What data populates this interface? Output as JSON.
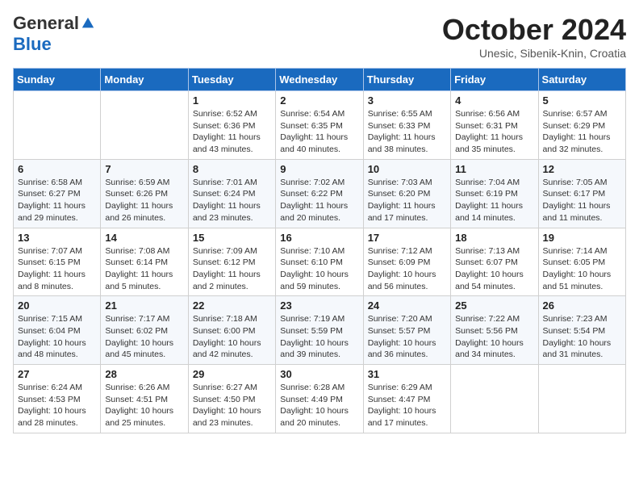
{
  "header": {
    "logo_general": "General",
    "logo_blue": "Blue",
    "month_title": "October 2024",
    "subtitle": "Unesic, Sibenik-Knin, Croatia"
  },
  "calendar": {
    "days_of_week": [
      "Sunday",
      "Monday",
      "Tuesday",
      "Wednesday",
      "Thursday",
      "Friday",
      "Saturday"
    ],
    "weeks": [
      [
        {
          "day": "",
          "content": ""
        },
        {
          "day": "",
          "content": ""
        },
        {
          "day": "1",
          "content": "Sunrise: 6:52 AM\nSunset: 6:36 PM\nDaylight: 11 hours and 43 minutes."
        },
        {
          "day": "2",
          "content": "Sunrise: 6:54 AM\nSunset: 6:35 PM\nDaylight: 11 hours and 40 minutes."
        },
        {
          "day": "3",
          "content": "Sunrise: 6:55 AM\nSunset: 6:33 PM\nDaylight: 11 hours and 38 minutes."
        },
        {
          "day": "4",
          "content": "Sunrise: 6:56 AM\nSunset: 6:31 PM\nDaylight: 11 hours and 35 minutes."
        },
        {
          "day": "5",
          "content": "Sunrise: 6:57 AM\nSunset: 6:29 PM\nDaylight: 11 hours and 32 minutes."
        }
      ],
      [
        {
          "day": "6",
          "content": "Sunrise: 6:58 AM\nSunset: 6:27 PM\nDaylight: 11 hours and 29 minutes."
        },
        {
          "day": "7",
          "content": "Sunrise: 6:59 AM\nSunset: 6:26 PM\nDaylight: 11 hours and 26 minutes."
        },
        {
          "day": "8",
          "content": "Sunrise: 7:01 AM\nSunset: 6:24 PM\nDaylight: 11 hours and 23 minutes."
        },
        {
          "day": "9",
          "content": "Sunrise: 7:02 AM\nSunset: 6:22 PM\nDaylight: 11 hours and 20 minutes."
        },
        {
          "day": "10",
          "content": "Sunrise: 7:03 AM\nSunset: 6:20 PM\nDaylight: 11 hours and 17 minutes."
        },
        {
          "day": "11",
          "content": "Sunrise: 7:04 AM\nSunset: 6:19 PM\nDaylight: 11 hours and 14 minutes."
        },
        {
          "day": "12",
          "content": "Sunrise: 7:05 AM\nSunset: 6:17 PM\nDaylight: 11 hours and 11 minutes."
        }
      ],
      [
        {
          "day": "13",
          "content": "Sunrise: 7:07 AM\nSunset: 6:15 PM\nDaylight: 11 hours and 8 minutes."
        },
        {
          "day": "14",
          "content": "Sunrise: 7:08 AM\nSunset: 6:14 PM\nDaylight: 11 hours and 5 minutes."
        },
        {
          "day": "15",
          "content": "Sunrise: 7:09 AM\nSunset: 6:12 PM\nDaylight: 11 hours and 2 minutes."
        },
        {
          "day": "16",
          "content": "Sunrise: 7:10 AM\nSunset: 6:10 PM\nDaylight: 10 hours and 59 minutes."
        },
        {
          "day": "17",
          "content": "Sunrise: 7:12 AM\nSunset: 6:09 PM\nDaylight: 10 hours and 56 minutes."
        },
        {
          "day": "18",
          "content": "Sunrise: 7:13 AM\nSunset: 6:07 PM\nDaylight: 10 hours and 54 minutes."
        },
        {
          "day": "19",
          "content": "Sunrise: 7:14 AM\nSunset: 6:05 PM\nDaylight: 10 hours and 51 minutes."
        }
      ],
      [
        {
          "day": "20",
          "content": "Sunrise: 7:15 AM\nSunset: 6:04 PM\nDaylight: 10 hours and 48 minutes."
        },
        {
          "day": "21",
          "content": "Sunrise: 7:17 AM\nSunset: 6:02 PM\nDaylight: 10 hours and 45 minutes."
        },
        {
          "day": "22",
          "content": "Sunrise: 7:18 AM\nSunset: 6:00 PM\nDaylight: 10 hours and 42 minutes."
        },
        {
          "day": "23",
          "content": "Sunrise: 7:19 AM\nSunset: 5:59 PM\nDaylight: 10 hours and 39 minutes."
        },
        {
          "day": "24",
          "content": "Sunrise: 7:20 AM\nSunset: 5:57 PM\nDaylight: 10 hours and 36 minutes."
        },
        {
          "day": "25",
          "content": "Sunrise: 7:22 AM\nSunset: 5:56 PM\nDaylight: 10 hours and 34 minutes."
        },
        {
          "day": "26",
          "content": "Sunrise: 7:23 AM\nSunset: 5:54 PM\nDaylight: 10 hours and 31 minutes."
        }
      ],
      [
        {
          "day": "27",
          "content": "Sunrise: 6:24 AM\nSunset: 4:53 PM\nDaylight: 10 hours and 28 minutes."
        },
        {
          "day": "28",
          "content": "Sunrise: 6:26 AM\nSunset: 4:51 PM\nDaylight: 10 hours and 25 minutes."
        },
        {
          "day": "29",
          "content": "Sunrise: 6:27 AM\nSunset: 4:50 PM\nDaylight: 10 hours and 23 minutes."
        },
        {
          "day": "30",
          "content": "Sunrise: 6:28 AM\nSunset: 4:49 PM\nDaylight: 10 hours and 20 minutes."
        },
        {
          "day": "31",
          "content": "Sunrise: 6:29 AM\nSunset: 4:47 PM\nDaylight: 10 hours and 17 minutes."
        },
        {
          "day": "",
          "content": ""
        },
        {
          "day": "",
          "content": ""
        }
      ]
    ]
  }
}
